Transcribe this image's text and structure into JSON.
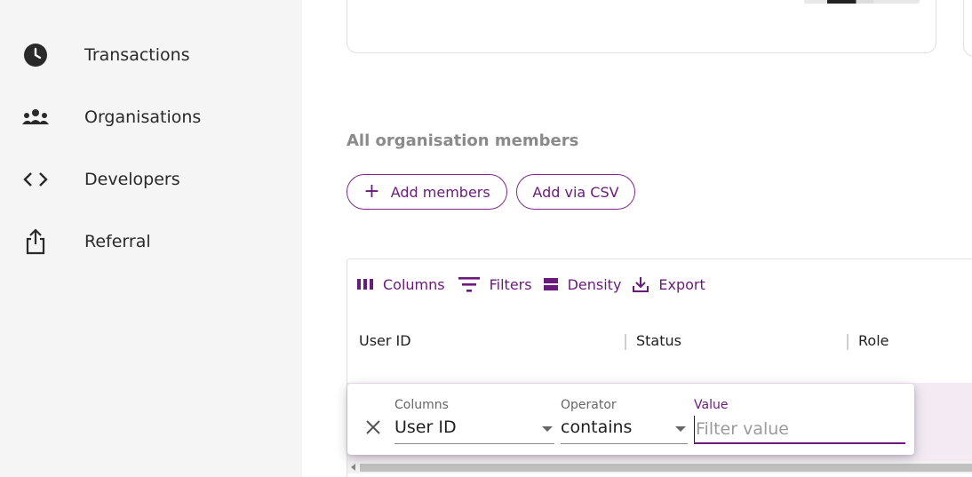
{
  "sidebar": {
    "items": [
      {
        "label": "Transactions",
        "icon": "clock-icon"
      },
      {
        "label": "Organisations",
        "icon": "group-icon"
      },
      {
        "label": "Developers",
        "icon": "code-icon"
      },
      {
        "label": "Referral",
        "icon": "share-icon"
      }
    ]
  },
  "main": {
    "section_title": "All organisation members",
    "buttons": {
      "add_members": "Add members",
      "add_csv": "Add via CSV"
    },
    "toolbar": {
      "columns": "Columns",
      "filters": "Filters",
      "density": "Density",
      "export": "Export"
    },
    "table": {
      "headers": [
        "User ID",
        "Status",
        "Role"
      ]
    },
    "filter_panel": {
      "columns_label": "Columns",
      "columns_value": "User ID",
      "operator_label": "Operator",
      "operator_value": "contains",
      "value_label": "Value",
      "value_placeholder": "Filter value"
    }
  },
  "colors": {
    "accent": "#6a1b7a",
    "sidebar_bg": "#f5f5f5",
    "row_highlight": "#f3eaf3"
  }
}
